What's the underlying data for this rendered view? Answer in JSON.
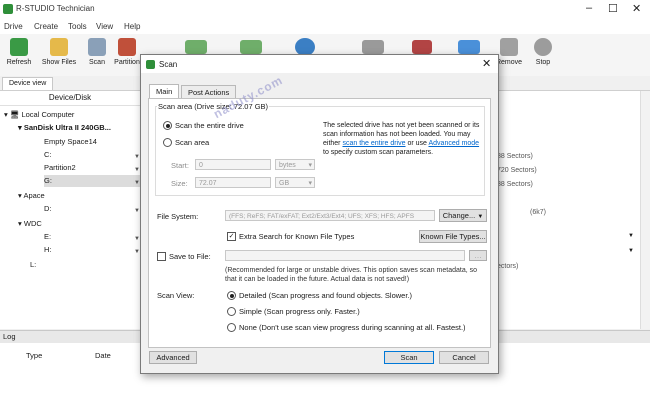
{
  "app": {
    "title": "R-STUDIO Technician",
    "menu": [
      "Drive",
      "Create",
      "Tools",
      "View",
      "Help"
    ]
  },
  "toolbar": {
    "buttons": [
      {
        "label": "Refresh",
        "icon": "refresh-icon"
      },
      {
        "label": "Show Files",
        "icon": "show-files-icon"
      },
      {
        "label": "Scan",
        "icon": "scan-icon"
      },
      {
        "label": "Partition",
        "icon": "partition-icon"
      },
      {
        "label": "Remove",
        "icon": "remove-icon"
      },
      {
        "label": "Stop",
        "icon": "stop-icon"
      }
    ]
  },
  "left": {
    "tab": "Device view",
    "header": "Device/Disk",
    "tree": [
      {
        "label": "Local Computer",
        "level": 0
      },
      {
        "label": "SanDisk Ultra II 240GB...",
        "level": 1
      },
      {
        "label": "Empty Space14",
        "level": 2
      },
      {
        "label": "C:",
        "level": 2
      },
      {
        "label": "Partition2",
        "level": 2
      },
      {
        "label": "G:",
        "level": 2
      },
      {
        "label": "Apace",
        "level": 1
      },
      {
        "label": "D:",
        "level": 2
      },
      {
        "label": "WDC",
        "level": 1
      },
      {
        "label": "E:",
        "level": 2
      },
      {
        "label": "H:",
        "level": 2
      },
      {
        "label": "L:",
        "level": 1
      }
    ],
    "right_texts": [
      "88 Sectors)",
      "720 Sectors)",
      "88 Sectors)",
      "(6k7)",
      "ectors)"
    ]
  },
  "log": {
    "title": "Log",
    "columns": [
      "Type",
      "Date"
    ]
  },
  "dialog": {
    "title": "Scan",
    "tabs": [
      "Main",
      "Post Actions"
    ],
    "scan_area_label": "Scan area (Drive size: 72.07 GB)",
    "radio_entire": "Scan the entire drive",
    "radio_area": "Scan area",
    "start_label": "Start:",
    "start_value": "0",
    "start_unit": "bytes",
    "size_label": "Size:",
    "size_value": "72.07",
    "size_unit": "GB",
    "info_part1": "The selected drive has not yet been scanned or its scan information has not been loaded. You may either ",
    "info_link1": "scan the entire drive",
    "info_part2": " or use ",
    "info_link2": "Advanced mode",
    "info_part3": " to specify custom scan parameters.",
    "file_system_label": "File System:",
    "file_system_value": "(FFS; ReFS; FAT/exFAT; Ext2/Ext3/Ext4; UFS; XFS; HFS; APFS",
    "change_button": "Change...",
    "extra_search_label": "Extra Search for Known File Types",
    "known_types_button": "Known File Types...",
    "save_to_file_label": "Save to File:",
    "save_note": "(Recommended for large or unstable drives. This option saves scan metadata, so that it can be loaded in the future. Actual data is not saved!)",
    "scan_view_label": "Scan View:",
    "view_detailed": "Detailed (Scan progress and found objects. Slower.)",
    "view_simple": "Simple (Scan progress only. Faster.)",
    "view_none": "None (Don't use scan view progress during scanning at all. Fastest.)",
    "advanced_button": "Advanced",
    "scan_button": "Scan",
    "cancel_button": "Cancel"
  },
  "watermark": "naduty.com",
  "colors": {
    "accent": "#0078d7",
    "link": "#0066cc",
    "logo": "#2f8f3a"
  }
}
